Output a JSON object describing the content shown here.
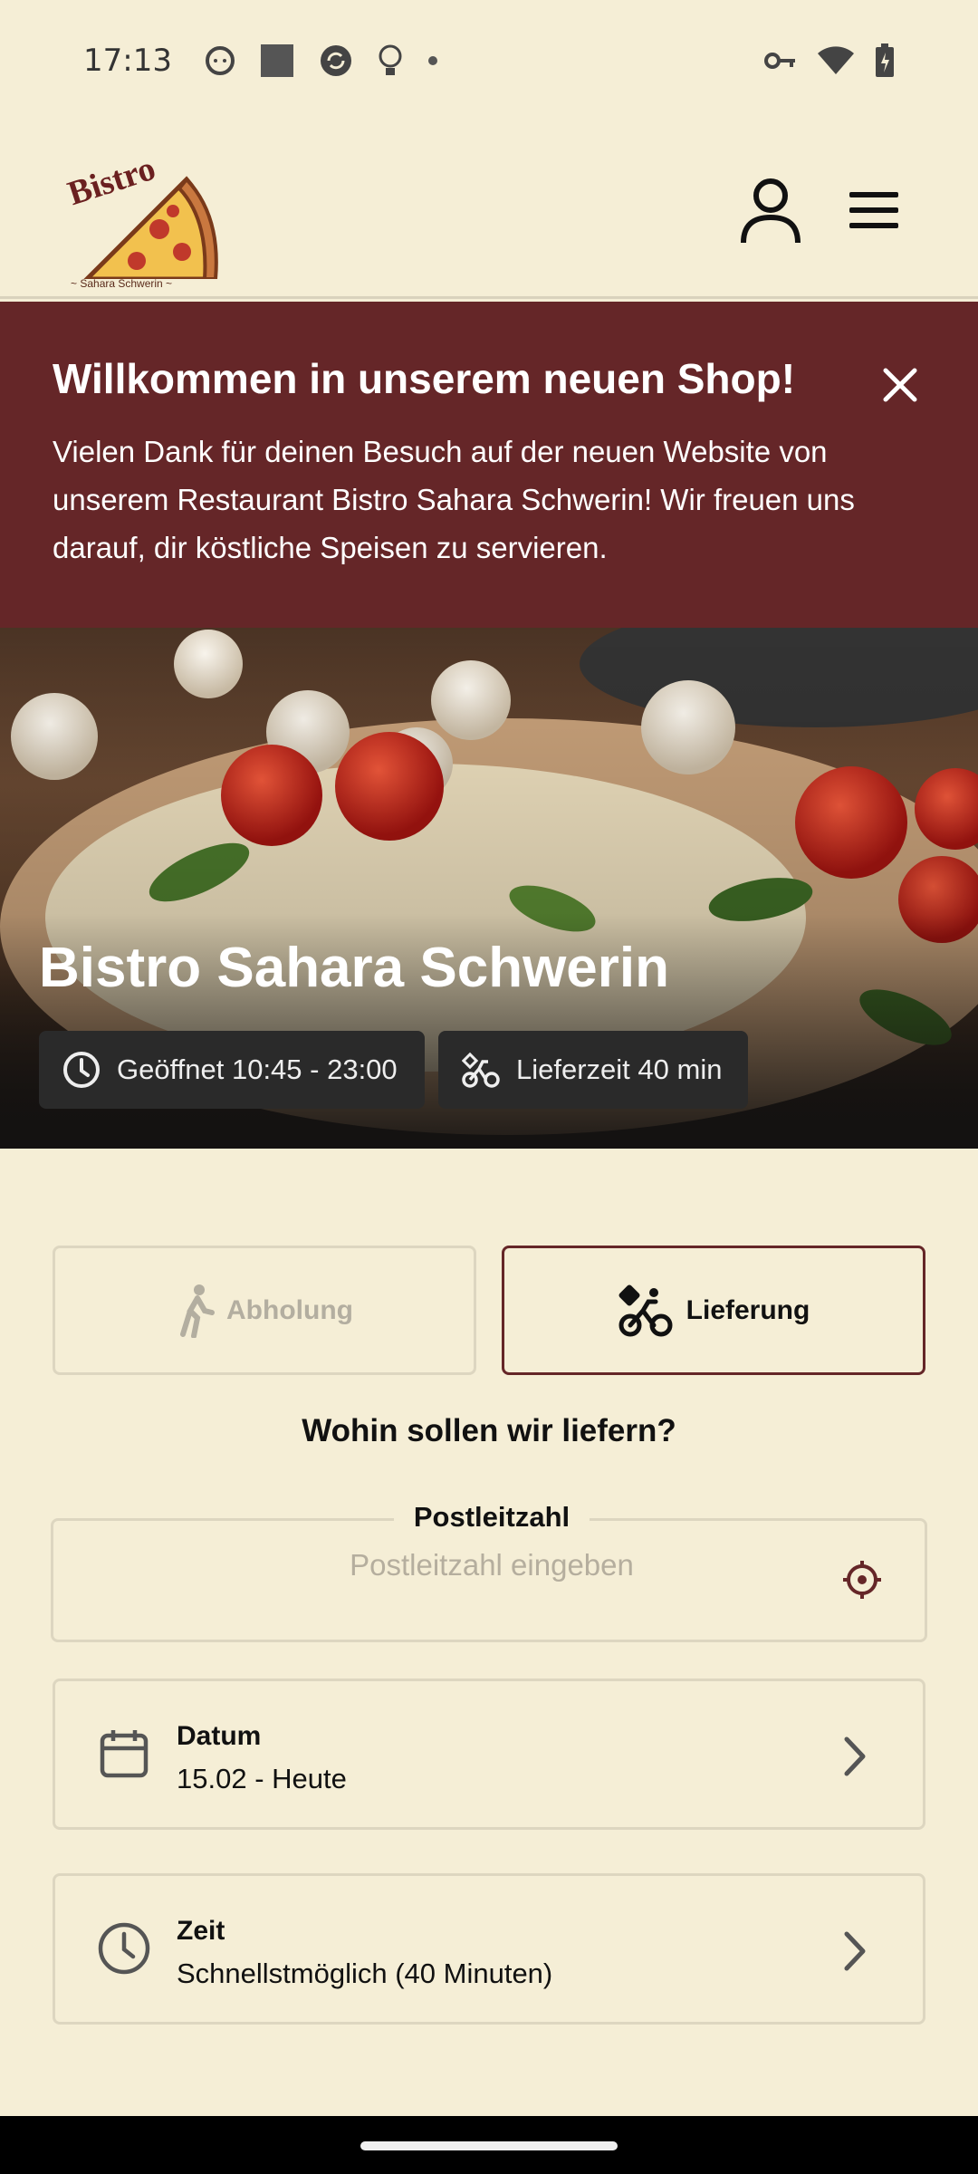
{
  "status_bar": {
    "time": "17:13",
    "icons_left": [
      "face-icon",
      "square-icon",
      "sync-icon",
      "bulb-icon",
      "dot-icon"
    ],
    "icons_right": [
      "key-icon",
      "wifi-icon",
      "battery-icon"
    ]
  },
  "header": {
    "logo_text": "Bistro",
    "logo_subtext": "~ Sahara Schwerin ~",
    "account_icon": "user-icon",
    "menu_icon": "hamburger-menu-icon"
  },
  "banner": {
    "title": "Willkommen in unserem neuen Shop!",
    "text": "Vielen Dank für deinen Besuch auf der neuen Website von unserem Restaurant Bistro Sahara Schwerin! Wir freuen uns darauf, dir köstliche Speisen zu servieren."
  },
  "hero": {
    "restaurant_name": "Bistro Sahara Schwerin",
    "opening_hours": "Geöffnet 10:45 - 23:00",
    "delivery_time": "Lieferzeit 40 min"
  },
  "mode": {
    "pickup_label": "Abholung",
    "delivery_label": "Lieferung",
    "selected": "Lieferung"
  },
  "delivery_question": "Wohin sollen wir liefern?",
  "postal": {
    "label": "Postleitzahl",
    "placeholder": "Postleitzahl eingeben",
    "value": ""
  },
  "date_select": {
    "label": "Datum",
    "value": "15.02 - Heute"
  },
  "time_select": {
    "label": "Zeit",
    "value": "Schnellstmöglich (40 Minuten)"
  },
  "colors": {
    "background": "#f5eed6",
    "accent": "#652628",
    "border": "#ddd6c0"
  }
}
